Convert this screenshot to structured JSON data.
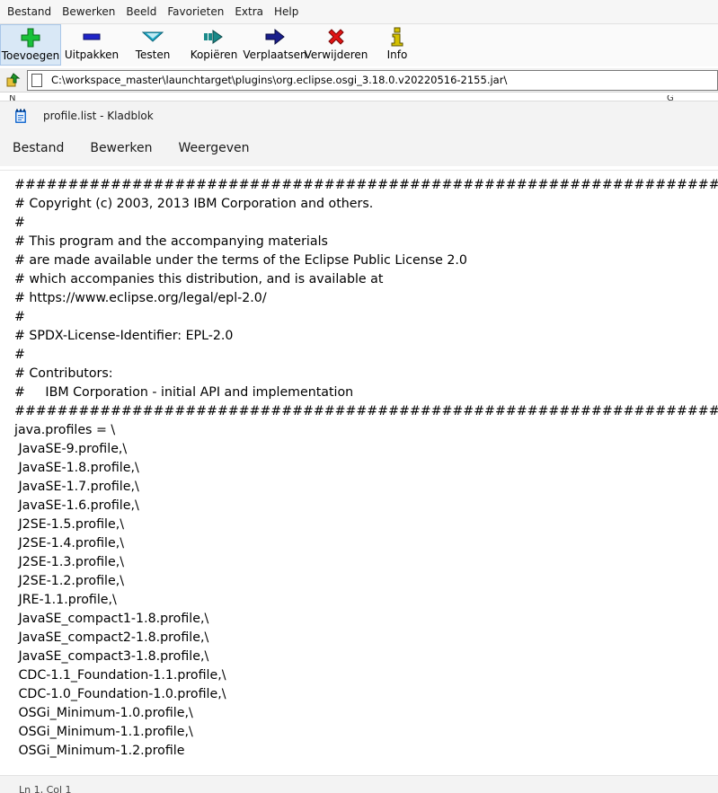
{
  "archive": {
    "menu": [
      "Bestand",
      "Bewerken",
      "Beeld",
      "Favorieten",
      "Extra",
      "Help"
    ],
    "toolbar": [
      {
        "label": "Toevoegen",
        "icon": "plus-icon"
      },
      {
        "label": "Uitpakken",
        "icon": "minus-icon"
      },
      {
        "label": "Testen",
        "icon": "check-chevron-icon"
      },
      {
        "label": "Kopiëren",
        "icon": "copy-arrow-icon"
      },
      {
        "label": "Verplaatsen",
        "icon": "move-arrow-icon"
      },
      {
        "label": "Verwijderen",
        "icon": "delete-x-icon"
      },
      {
        "label": "Info",
        "icon": "info-icon"
      }
    ],
    "path": "C:\\workspace_master\\launchtarget\\plugins\\org.eclipse.osgi_3.18.0.v20220516-2155.jar\\",
    "colors": {
      "plus": "#19c13a",
      "minus": "#1f24c8",
      "check": "#1aa8c8",
      "copy": "#1a8a8a",
      "move": "#1a1f8c",
      "delete": "#e01414",
      "info": "#d4c000"
    }
  },
  "notepad": {
    "title": "profile.list - Kladblok",
    "menu": [
      "Bestand",
      "Bewerken",
      "Weergeven"
    ],
    "lines": [
      "###############################################################################",
      "# Copyright (c) 2003, 2013 IBM Corporation and others.",
      "#",
      "# This program and the accompanying materials",
      "# are made available under the terms of the Eclipse Public License 2.0",
      "# which accompanies this distribution, and is available at",
      "# https://www.eclipse.org/legal/epl-2.0/",
      "#",
      "# SPDX-License-Identifier: EPL-2.0",
      "#",
      "# Contributors:",
      "#     IBM Corporation - initial API and implementation",
      "###############################################################################",
      "java.profiles = \\",
      " JavaSE-9.profile,\\",
      " JavaSE-1.8.profile,\\",
      " JavaSE-1.7.profile,\\",
      " JavaSE-1.6.profile,\\",
      " J2SE-1.5.profile,\\",
      " J2SE-1.4.profile,\\",
      " J2SE-1.3.profile,\\",
      " J2SE-1.2.profile,\\",
      " JRE-1.1.profile,\\",
      " JavaSE_compact1-1.8.profile,\\",
      " JavaSE_compact2-1.8.profile,\\",
      " JavaSE_compact3-1.8.profile,\\",
      " CDC-1.1_Foundation-1.1.profile,\\",
      " CDC-1.0_Foundation-1.0.profile,\\",
      " OSGi_Minimum-1.0.profile,\\",
      " OSGi_Minimum-1.1.profile,\\",
      " OSGi_Minimum-1.2.profile"
    ],
    "status": "Ln 1, Col 1"
  }
}
